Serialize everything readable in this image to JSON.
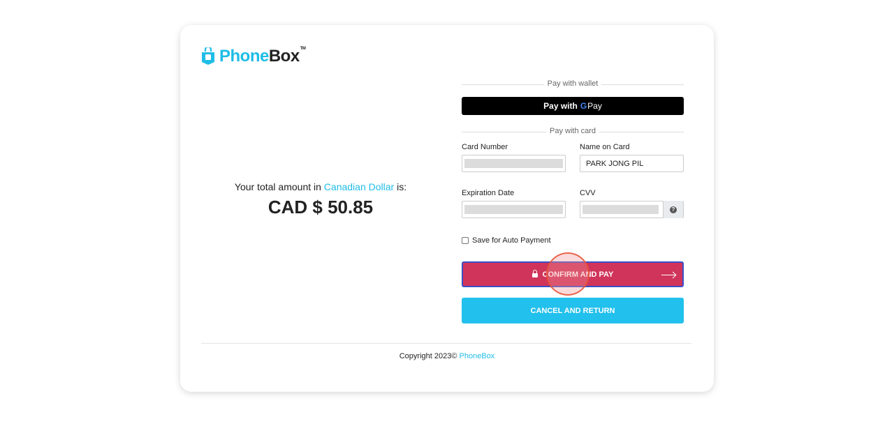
{
  "brand": {
    "name_part1": "Phone",
    "name_part2": "Box",
    "trademark": "TM",
    "accent_color": "#1fbde7"
  },
  "summary": {
    "prefix": "Your total amount in ",
    "currency_name": "Canadian Dollar",
    "suffix": " is:",
    "amount": "CAD $ 50.85"
  },
  "wallet": {
    "divider_label": "Pay with wallet",
    "gpay_label": "Pay with",
    "gpay_g": "G",
    "gpay_pay": "Pay"
  },
  "card": {
    "divider_label": "Pay with card",
    "card_number_label": "Card Number",
    "card_number_value": "",
    "name_label": "Name on Card",
    "name_value": "PARK JONG PIL",
    "expiry_label": "Expiration Date",
    "expiry_value": "",
    "cvv_label": "CVV",
    "cvv_value": "",
    "cvv_help_icon": "?"
  },
  "save_auto_payment": {
    "label": "Save for Auto Payment",
    "checked": false
  },
  "actions": {
    "confirm_label": "CONFIRM AND PAY",
    "confirm_color": "#d0345a",
    "cancel_label": "CANCEL AND RETURN",
    "cancel_color": "#22c0ec"
  },
  "footer": {
    "copyright": "Copyright 2023© ",
    "brand_link": "PhoneBox"
  }
}
